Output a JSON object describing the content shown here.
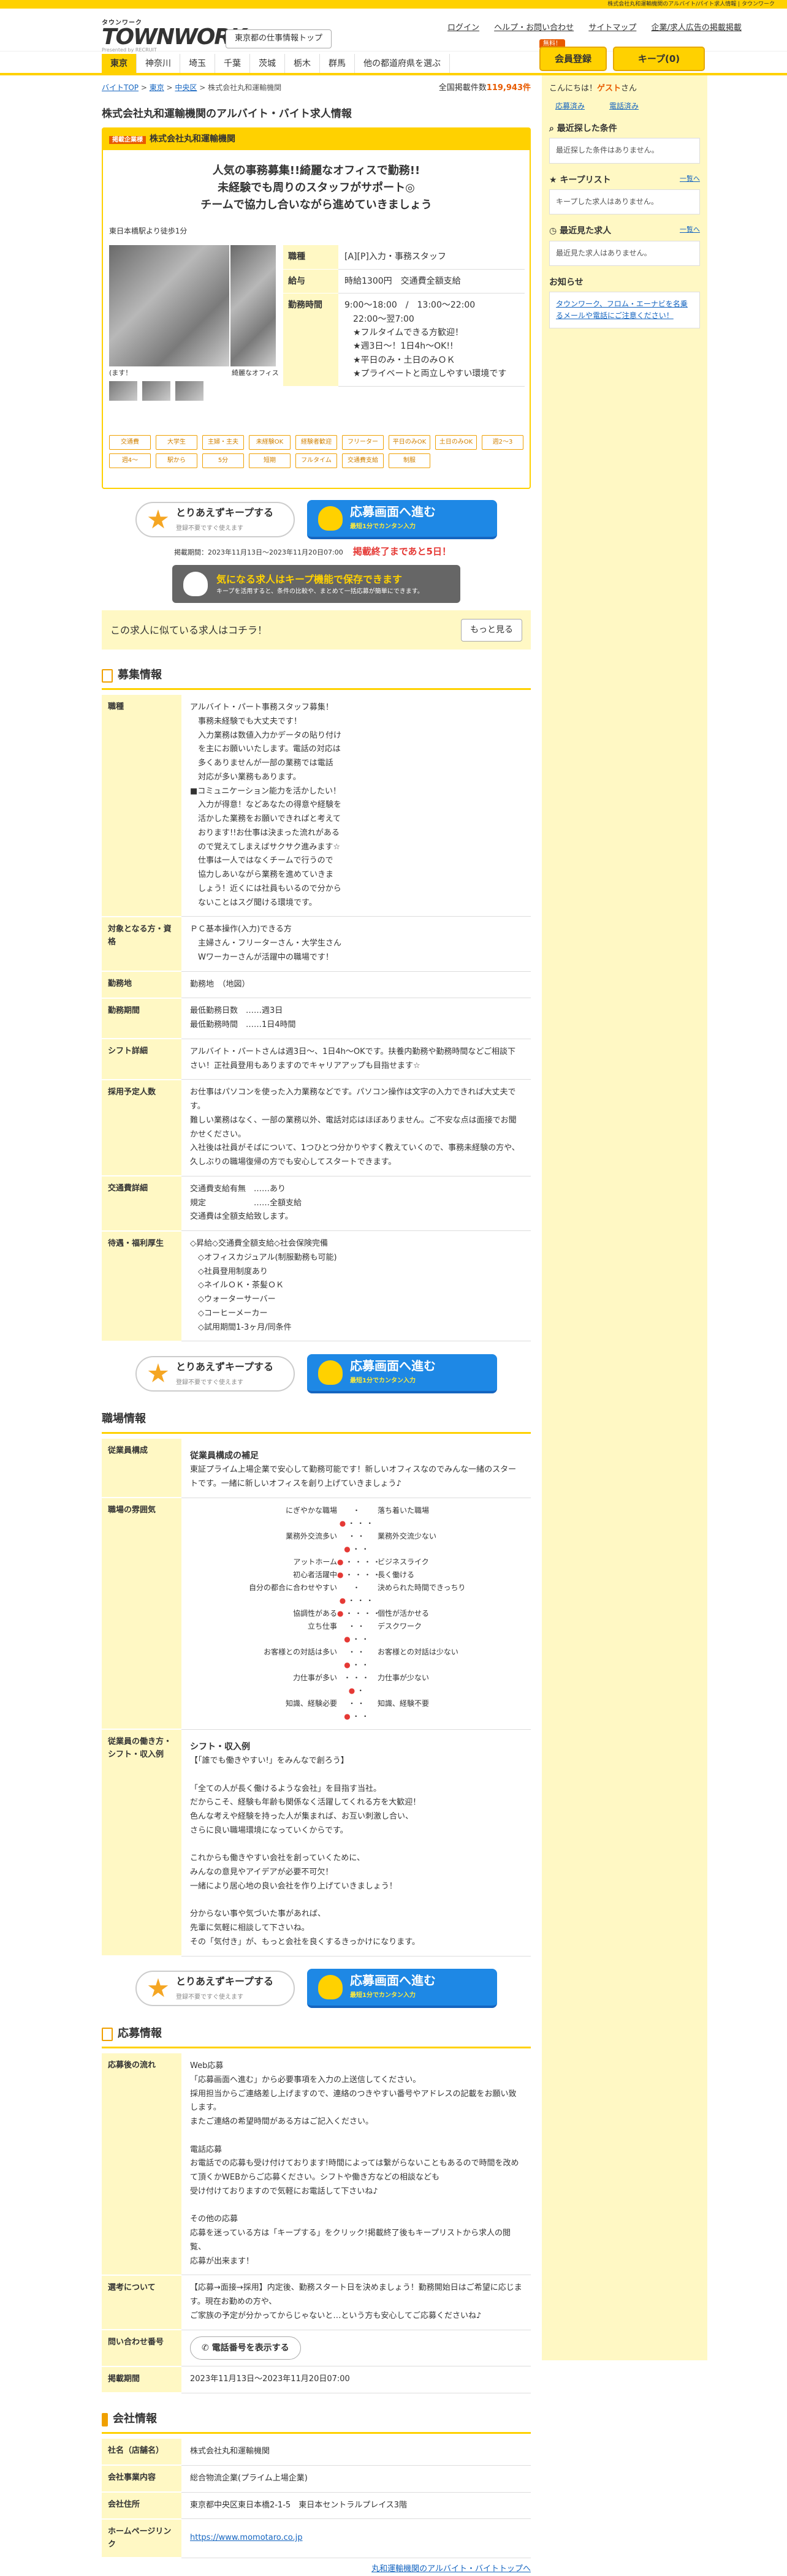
{
  "topbar": "株式会社丸和運輸機関のアルバイト/パイト求人情報 | タウンワーク",
  "header": {
    "logo_small": "タウンワーク",
    "logo_big": "TOWNWORK",
    "logo_by": "Presented by RECRUIT",
    "area_button": "東京都の仕事情報トップ",
    "links": [
      "ログイン",
      "ヘルプ・お問い合わせ",
      "サイトマップ",
      "企業/求人広告の掲載掲載"
    ],
    "register_badge": "無料！",
    "register": "会員登録",
    "keep": "キープ(0)"
  },
  "nav": [
    "東京",
    "神奈川",
    "埼玉",
    "千葉",
    "茨城",
    "栃木",
    "群馬",
    "他の都道府県を選ぶ"
  ],
  "breadcrumb": [
    "バイトTOP",
    "東京",
    "中央区",
    "株式会社丸和運輸機関"
  ],
  "total": {
    "label": "全国掲載件数",
    "count": "119,943件"
  },
  "title": "株式会社丸和運輸機関のアルバイト・バイト求人情報",
  "job": {
    "tag": "掲載企業様",
    "company": "株式会社丸和運輸機関",
    "catch": [
      "人気の事務募集!!綺麗なオフィスで勤務!!",
      "未経験でも周りのスタッフがサポート◎",
      "チームで協力し合いながら進めていきましょう"
    ],
    "station": "東日本橋駅より徒歩1分",
    "caption1": "(ます！",
    "caption2": "綺麗なオフィス",
    "info": [
      {
        "k": "職種",
        "v": "[A][P]入力・事務スタッフ"
      },
      {
        "k": "給与",
        "v": "時給1300円　交通費全額支給"
      },
      {
        "k": "勤務時間",
        "v": "9:00〜18:00　/　13:00〜22:00\n　22:00〜翌7:00\n　★フルタイムできる方歓迎！\n　★週3日〜！1日4h〜OK!!\n　★平日のみ・土日のみＯＫ\n　★プライベートと両立しやすい環境です"
      }
    ],
    "tags": [
      "交通費",
      "大学生",
      "主婦・主夫",
      "未経験OK",
      "経験者歓迎",
      "フリーター",
      "平日のみOK",
      "土日のみOK",
      "週2〜3",
      "週4〜",
      "駅から",
      "5分",
      "短期",
      "フルタイム",
      "交通費支給",
      "制服"
    ],
    "keep_btn": "とりあえずキープする",
    "keep_sub": "登録不要ですぐ使えます",
    "apply_btn": "応募画面へ進む",
    "apply_sub": "最短1分でカンタン入力",
    "period": "掲載期間：2023年11月13日〜2023年11月20日07:00",
    "deadline": "掲載終了まであと5日！",
    "gray_title": "気になる求人はキープ機能で保存できます",
    "gray_sub": "キープを活用すると、条件の比較や、まとめて一括応募が簡単にできます。",
    "similar": "この求人に似ている求人はコチラ！",
    "more": "もっと見る"
  },
  "recruit": {
    "title": "募集情報",
    "rows": [
      {
        "k": "職種",
        "v": "アルバイト・パート事務スタッフ募集！\n　事務未経験でも大丈夫です！\n　入力業務は数値入力かデータの貼り付け\n　を主にお願いいたします。電話の対応は\n　多くありませんが一部の業務では電話\n　対応が多い業務もあります。\n■コミュニケーション能力を活かしたい！\n　入力が得意！などあなたの得意や経験を\n　活かした業務をお願いできればと考えて\n　おります!!お仕事は決まった流れがある\n　ので覚えてしまえばサクサク進みます☆\n　仕事は一人ではなくチームで行うので\n　協力しあいながら業務を進めていきま\n　しょう！近くには社員もいるので分から\n　ないことはスグ聞ける環境です。"
      },
      {
        "k": "対象となる方・資格",
        "v": "ＰＣ基本操作(入力)できる方\n　主婦さん・フリーターさん・大学生さん\n　Wワーカーさんが活躍中の職場です！"
      },
      {
        "k": "勤務地",
        "v": "勤務地　（地図）"
      },
      {
        "k": "勤務期間",
        "v": "最低勤務日数　……週3日\n最低勤務時間　……1日4時間"
      },
      {
        "k": "シフト詳細",
        "v": "アルバイト・パートさんは週3日〜、1日4h〜OKです。扶養内勤務や勤務時間などご相談下さい！正社員登用もありますのでキャリアアップも目指せます☆"
      },
      {
        "k": "採用予定人数",
        "v": "お仕事はパソコンを使った入力業務などです。パソコン操作は文字の入力できれば大丈夫です。\n難しい業務はなく、一部の業務以外、電話対応はほぼありません。ご不安な点は面接でお聞かせください。\n入社後は社員がそばについて、1つひとつ分かりやすく教えていくので、事務未経験の方や、久しぶりの職場復帰の方でも安心してスタートできます。"
      },
      {
        "k": "交通費詳細",
        "v": "交通費支給有無　……あり\n規定　　　　　　……全額支給\n交通費は全額支給致します。"
      },
      {
        "k": "待遇・福利厚生",
        "v": "◇昇給◇交通費全額支給◇社会保険完備\n　◇オフィスカジュアル(制服勤務も可能)\n　◇社員登用制度あり\n　◇ネイルＯＫ・茶髪ＯＫ\n　◇ウォーターサーバー\n　◇コーヒーメーカー\n　◇試用期間1-3ヶ月/同条件"
      }
    ]
  },
  "workplace": {
    "title": "職場情報",
    "staff_head": "従業員構成の補足",
    "staff_text": "東証プライム上場企業で安心して勤務可能です！新しいオフィスなのでみんな一緒のスタートです。一緒に新しいオフィスを創り上げていきましょう♪",
    "scale": [
      {
        "l": "にぎやかな職場",
        "p": 2,
        "r": "落ち着いた職場"
      },
      {
        "l": "業務外交流多い",
        "p": 3,
        "r": "業務外交流少ない"
      },
      {
        "l": "アットホーム",
        "p": 1,
        "r": "ビジネスライク"
      },
      {
        "l": "初心者活躍中",
        "p": 1,
        "r": "長く働ける"
      },
      {
        "l": "自分の都合に合わせやすい",
        "p": 2,
        "r": "決められた時間できっちり"
      },
      {
        "l": "協調性がある",
        "p": 1,
        "r": "個性が活かせる"
      },
      {
        "l": "立ち仕事",
        "p": 3,
        "r": "デスクワーク"
      },
      {
        "l": "お客様との対話は多い",
        "p": 3,
        "r": "お客様との対話は少ない"
      },
      {
        "l": "力仕事が多い",
        "p": 4,
        "r": "力仕事が少ない"
      },
      {
        "l": "知識、経験必要",
        "p": 3,
        "r": "知識、経験不要"
      }
    ],
    "work_head": "シフト・収入例",
    "work_text": "【「誰でも働きやすい!」をみんなで創ろう】\n\n「全ての人が長く働けるような会社」を目指す当社。\nだからこそ、経験も年齢も関係なく活躍してくれる方を大歓迎！\n色んな考えや経験を持った人が集まれば、お互い刺激し合い、\nさらに良い職場環境になっていくからです。\n\nこれからも働きやすい会社を創っていくために、\nみんなの意見やアイデアが必要不可欠！\n一緒により居心地の良い会社を作り上げていきましょう！\n\n分からない事や気づいた事があれば、\n先輩に気軽に相談して下さいね。\nその「気付き」が、もっと会社を良くするきっかけになります。"
  },
  "apply": {
    "title": "応募情報",
    "flow": "Web応募\n「応募画面へ進む」から必要事項を入力の上送信してください。\n採用担当からご連絡差し上げますので、連絡のつきやすい番号やアドレスの記載をお願い致します。\nまたご連絡の希望時間がある方はご記入ください。\n\n電話応募\nお電話での応募も受け付けております!時間によっては繋がらないこともあるので時間を改めて頂くかWEBからご応募ください。シフトや働き方などの相談なども\n受け付けておりますので気軽にお電話して下さいね♪\n\nその他の応募\n応募を迷っている方は「キープする」をクリック!掲載終了後もキープリストから求人の閲覧、\n応募が出来ます！",
    "contact": "【応募→面接→採用】内定後、勤務スタート日を決めましょう！勤務開始日はご希望に応じます。現在お勤めの方や、\nご家族の予定が分かってからじゃないと…という方も安心してご応募くださいね♪",
    "phone": "電話番号を表示する",
    "period": "2023年11月13日〜2023年11月20日07:00",
    "labels": [
      "応募後の流れ",
      "選考について",
      "問い合わせ番号",
      "掲載期間"
    ]
  },
  "company": {
    "title": "会社情報",
    "rows": [
      {
        "k": "社名（店舗名）",
        "v": "株式会社丸和運輸機関"
      },
      {
        "k": "会社事業内容",
        "v": "総合物流企業(プライム上場企業)"
      },
      {
        "k": "会社住所",
        "v": "東京都中央区東日本橋2-1-5　東日本セントラルプレイス3階"
      },
      {
        "k": "ホームページリンク",
        "v": "https://www.momotaro.co.jp"
      }
    ],
    "footer_link": "丸和運輸機関のアルバイト・バイトトップへ"
  },
  "sidebar": {
    "greeting": "こんにちは！",
    "guest": "ゲスト",
    "suffix": "さん",
    "links": [
      "応募済み",
      "電話済み"
    ],
    "recent_cond": "最近探した条件",
    "recent_cond_empty": "最近探した条件はありません。",
    "keep_title": "キープリスト",
    "keep_more": "一覧へ",
    "keep_empty": "キープした求人はありません。",
    "seen_title": "最近見た求人",
    "seen_more": "一覧へ",
    "seen_empty": "最近見た求人はありません。",
    "notice_title": "お知らせ",
    "notice": "タウンワーク、フロム・エーナビを名乗るメールや電話にご注意ください！"
  }
}
